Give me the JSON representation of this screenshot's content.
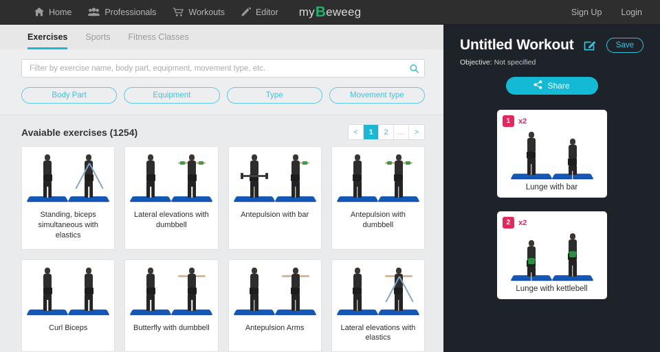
{
  "navbar": {
    "items": [
      {
        "label": "Home",
        "icon": "home-icon"
      },
      {
        "label": "Professionals",
        "icon": "people-icon"
      },
      {
        "label": "Workouts",
        "icon": "cart-icon"
      },
      {
        "label": "Editor",
        "icon": "pencil-icon"
      }
    ],
    "logo": {
      "pre": "my",
      "mark": "B",
      "post": "eweeg"
    },
    "auth": {
      "signup": "Sign Up",
      "login": "Login"
    }
  },
  "tabs": [
    {
      "label": "Exercises",
      "active": true
    },
    {
      "label": "Sports",
      "active": false
    },
    {
      "label": "Fitness Classes",
      "active": false
    }
  ],
  "search": {
    "value": "",
    "placeholder": "Filter by exercise name, body part, equipment, movement type, etc.",
    "icon": "search-icon"
  },
  "filters": [
    {
      "label": "Body Part"
    },
    {
      "label": "Equipment"
    },
    {
      "label": "Type"
    },
    {
      "label": "Movement type"
    }
  ],
  "results": {
    "title": "Avaiable exercises (1254)",
    "count": 1254,
    "pager": {
      "prev": "<",
      "pages": [
        "1",
        "2"
      ],
      "active_page": "1",
      "dots": "...",
      "next": ">"
    }
  },
  "exercises": [
    {
      "label": "Standing, biceps simultaneous with elastics",
      "equipment": "elastics"
    },
    {
      "label": "Lateral elevations with dumbbell",
      "equipment": "dumbbell"
    },
    {
      "label": "Antepulsion with bar",
      "equipment": "bar"
    },
    {
      "label": "Antepulsion with dumbbell",
      "equipment": "dumbbell"
    },
    {
      "label": "Curl Biceps",
      "equipment": "none"
    },
    {
      "label": "Butterfly with dumbbell",
      "equipment": "dumbbell"
    },
    {
      "label": "Antepulsion Arms",
      "equipment": "none"
    },
    {
      "label": "Lateral elevations with elastics",
      "equipment": "elastics"
    }
  ],
  "workout": {
    "title": "Untitled Workout",
    "edit_icon": "edit-pencil-icon",
    "save_label": "Save",
    "objective_label": "Objective:",
    "objective_value": "Not specified",
    "share_label": "Share",
    "share_icon": "share-icon",
    "items": [
      {
        "number": "1",
        "reps": "x2",
        "name": "Lunge with bar",
        "equipment": "bar"
      },
      {
        "number": "2",
        "reps": "x2",
        "name": "Lunge with kettlebell",
        "equipment": "kettlebell"
      }
    ]
  },
  "colors": {
    "accent_cyan": "#1bb8d4",
    "brand_green": "#19b46e",
    "badge_pink": "#e8265e",
    "panel_dark": "#1d2329",
    "navbar_dark": "#2e2e2e"
  }
}
